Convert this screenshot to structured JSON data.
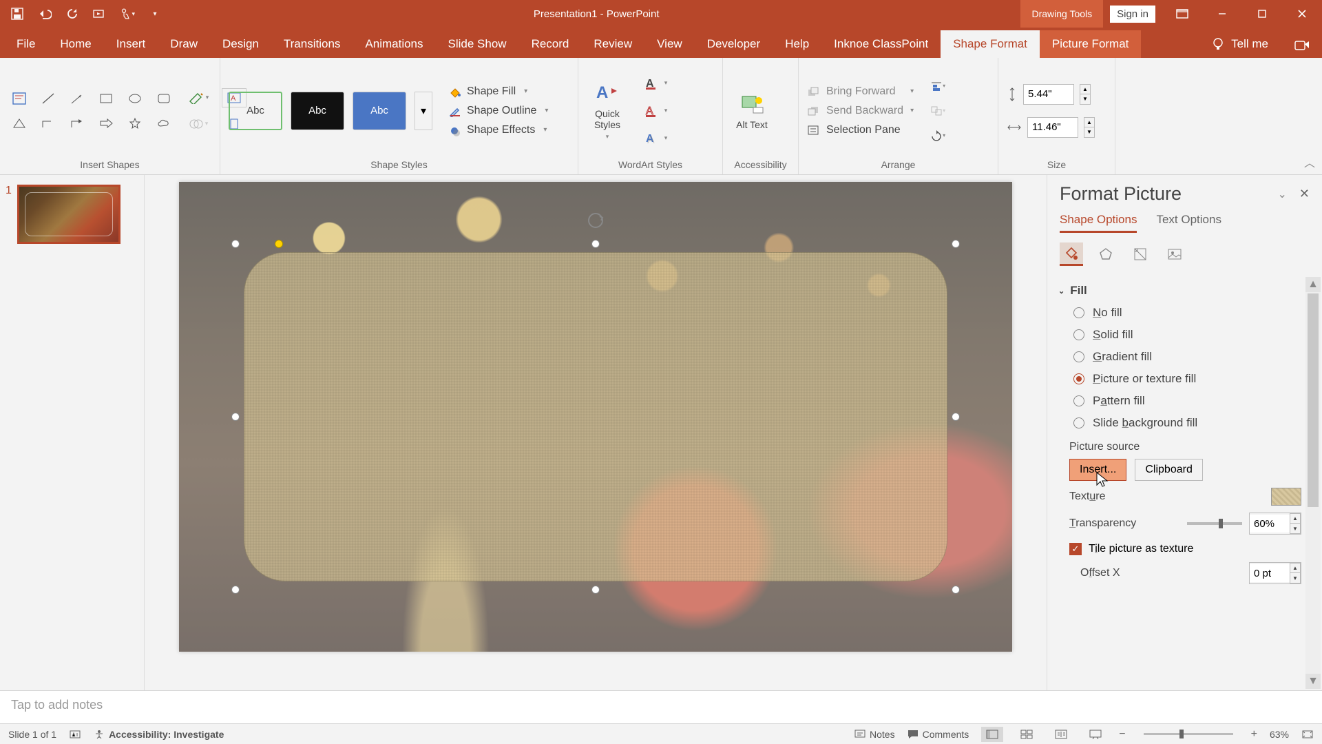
{
  "titlebar": {
    "title": "Presentation1 - PowerPoint",
    "context_tab": "Drawing Tools",
    "signin": "Sign in"
  },
  "ribbon_tabs": {
    "file": "File",
    "home": "Home",
    "insert": "Insert",
    "draw": "Draw",
    "design": "Design",
    "transitions": "Transitions",
    "animations": "Animations",
    "slideshow": "Slide Show",
    "record": "Record",
    "review": "Review",
    "view": "View",
    "developer": "Developer",
    "help": "Help",
    "iknoe": "Inknoe ClassPoint",
    "shape_format": "Shape Format",
    "picture_format": "Picture Format",
    "tellme": "Tell me"
  },
  "ribbon": {
    "group_insert_shapes": "Insert Shapes",
    "group_shape_styles": "Shape Styles",
    "group_wordart": "WordArt Styles",
    "group_accessibility": "Accessibility",
    "group_arrange": "Arrange",
    "group_size": "Size",
    "style_label": "Abc",
    "shape_fill": "Shape Fill",
    "shape_outline": "Shape Outline",
    "shape_effects": "Shape Effects",
    "quick_styles": "Quick Styles",
    "alt_text": "Alt Text",
    "bring_forward": "Bring Forward",
    "send_backward": "Send Backward",
    "selection_pane": "Selection Pane",
    "height": "5.44\"",
    "width": "11.46\""
  },
  "pane": {
    "title": "Format Picture",
    "tab_shape": "Shape Options",
    "tab_text": "Text Options",
    "fill_section": "Fill",
    "no_fill": "No fill",
    "solid_fill": "Solid fill",
    "gradient_fill": "Gradient fill",
    "picture_fill": "Picture or texture fill",
    "pattern_fill": "Pattern fill",
    "slide_bg_fill": "Slide background fill",
    "picture_source": "Picture source",
    "insert": "Insert...",
    "clipboard": "Clipboard",
    "texture": "Texture",
    "transparency": "Transparency",
    "transparency_val": "60%",
    "tile": "Tile picture as texture",
    "offset_x": "Offset X",
    "offset_x_val": "0 pt"
  },
  "notes": {
    "placeholder": "Tap to add notes"
  },
  "status": {
    "slide": "Slide 1 of 1",
    "accessibility": "Accessibility: Investigate",
    "notes": "Notes",
    "comments": "Comments",
    "zoom": "63%"
  },
  "thumbs": {
    "n1": "1"
  }
}
